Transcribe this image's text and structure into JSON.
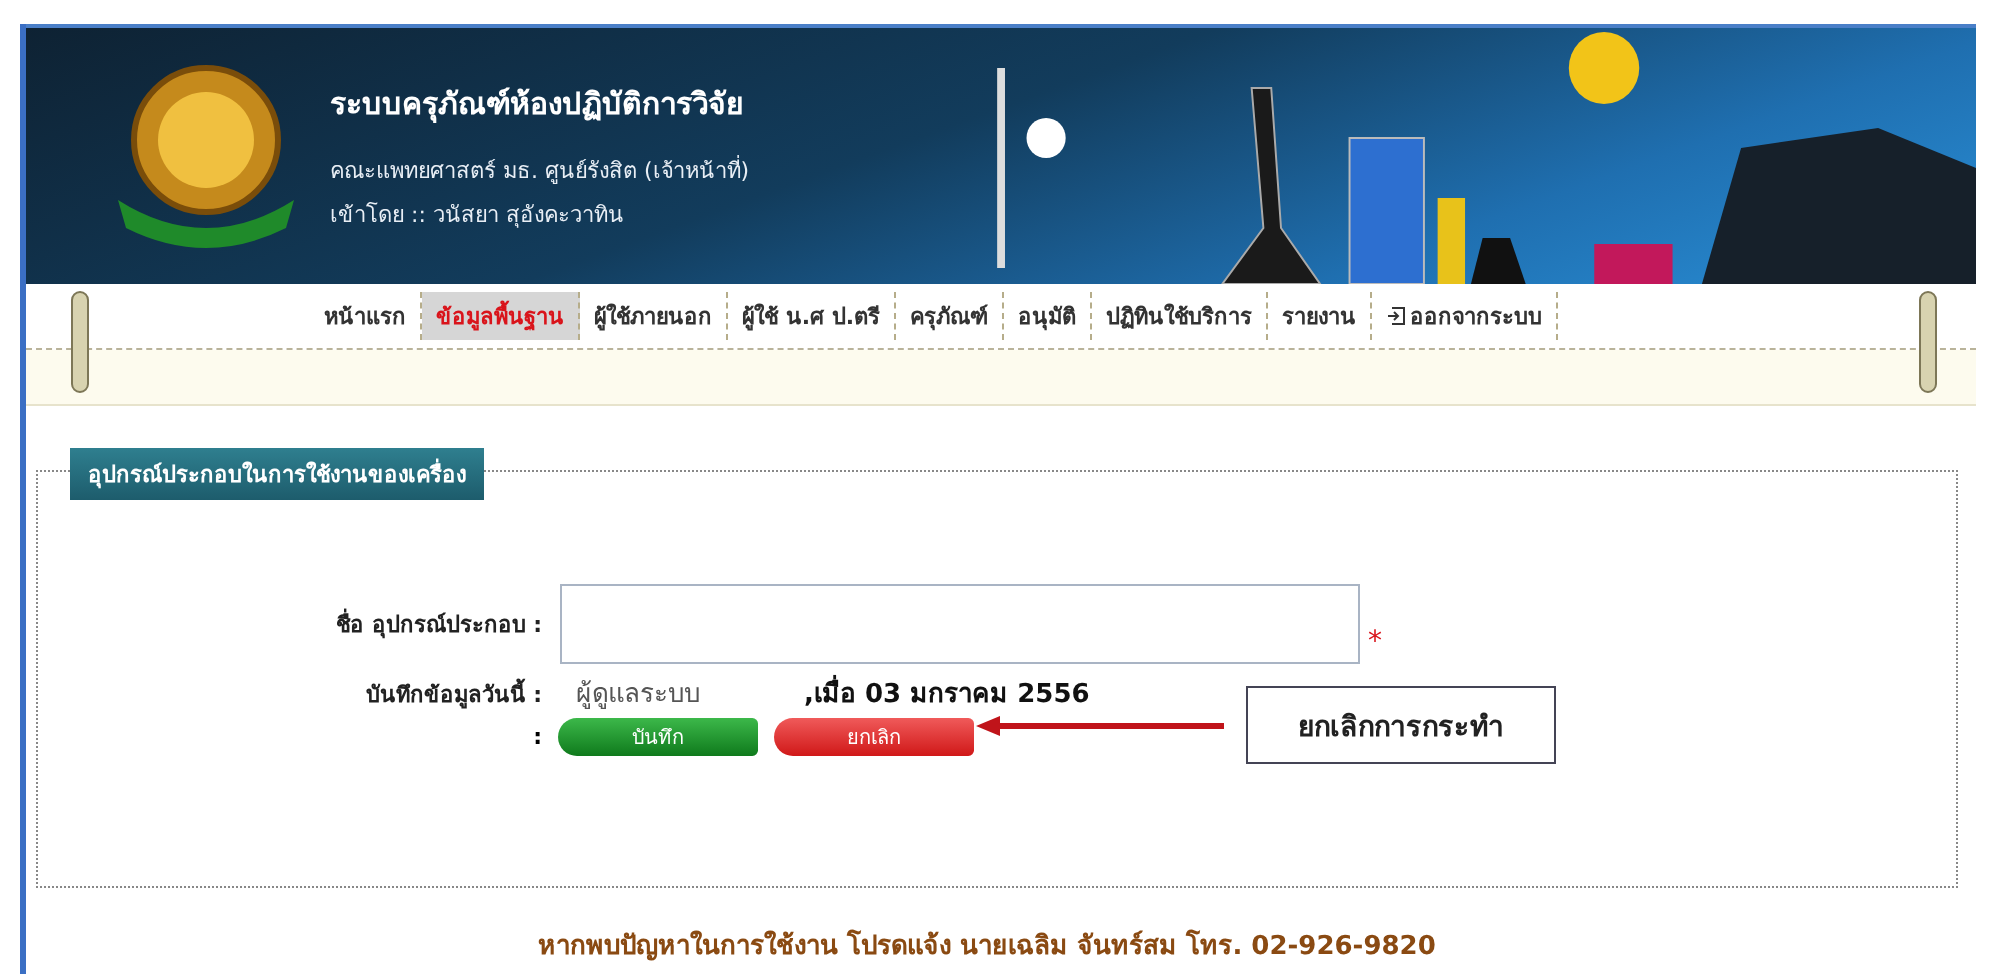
{
  "header": {
    "title": "ระบบครุภัณฑ์ห้องปฏิบัติการวิจัย",
    "subtitle": "คณะแพทยศาสตร์ มธ. ศูนย์รังสิต (เจ้าหน้าที่)",
    "login": "เข้าโดย :: วนัสยา สุอังคะวาทิน"
  },
  "nav": [
    {
      "label": "หน้าแรก",
      "selected": false
    },
    {
      "label": "ข้อมูลพื้นฐาน",
      "selected": true
    },
    {
      "label": "ผู้ใช้ภายนอก",
      "selected": false
    },
    {
      "label": "ผู้ใช้ น.ศ ป.ตรี",
      "selected": false
    },
    {
      "label": "ครุภัณฑ์",
      "selected": false
    },
    {
      "label": "อนุมัติ",
      "selected": false
    },
    {
      "label": "ปฏิทินใช้บริการ",
      "selected": false
    },
    {
      "label": "รายงาน",
      "selected": false
    },
    {
      "label": "ออกจากระบบ",
      "selected": false,
      "kind": "logout"
    }
  ],
  "form": {
    "legend": "อุปกรณ์ประกอบในการใช้งานของเครื่อง",
    "name_label": "ชื่อ อุปกรณ์ประกอบ :",
    "required_mark": "*",
    "record_label": "บันทึกข้อมูลวันนี้ :",
    "recorder": "ผู้ดูแลระบบ",
    "record_date": ",เมื่อ 03 มกราคม 2556",
    "buttons_colon": ":",
    "save_button": "บันทึก",
    "cancel_button": "ยกเลิก"
  },
  "callout": "ยกเลิกการกระทำ",
  "footer": "หากพบปัญหาในการใช้งาน โปรดแจ้ง นายเฉลิม จันทร์สม โทร. 02-926-9820"
}
